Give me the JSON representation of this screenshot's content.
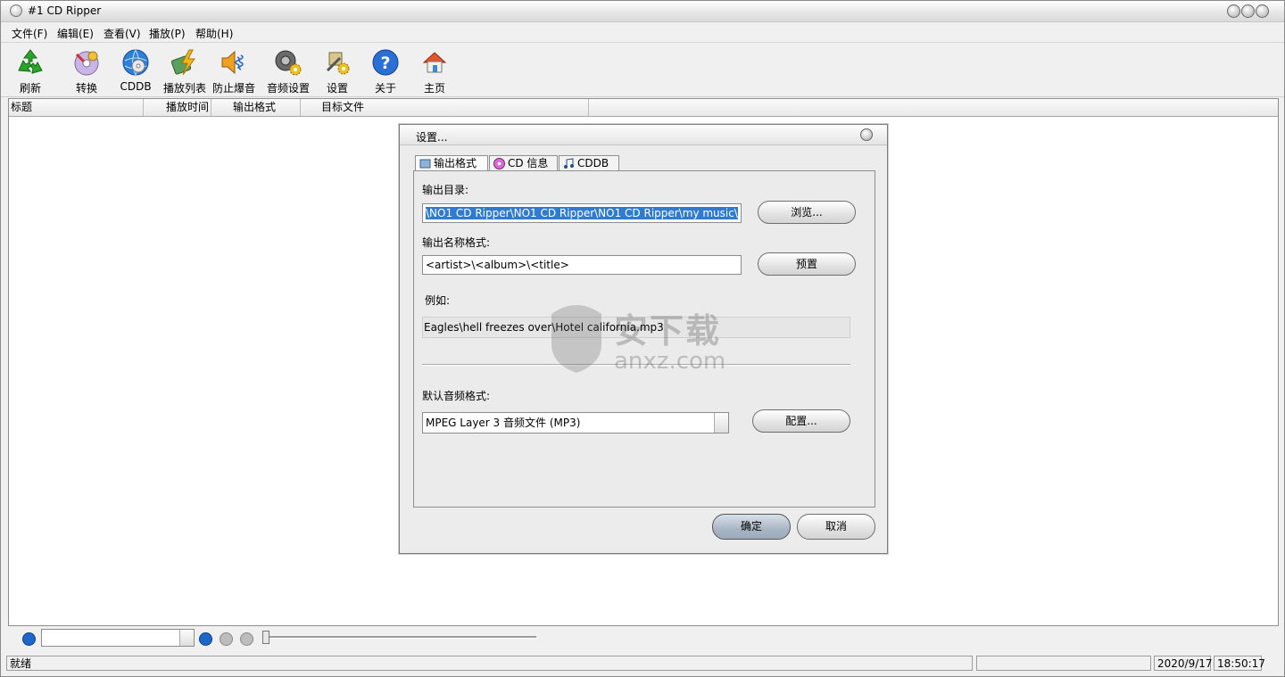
{
  "window": {
    "title": "#1 CD Ripper"
  },
  "menu": [
    {
      "label": "文件(F)"
    },
    {
      "label": "编辑(E)"
    },
    {
      "label": "查看(V)"
    },
    {
      "label": "播放(P)"
    },
    {
      "label": "帮助(H)"
    }
  ],
  "toolbar": [
    {
      "label": "刷新",
      "icon": "recycle-icon"
    },
    {
      "label": "转换",
      "icon": "disc-convert-icon"
    },
    {
      "label": "CDDB",
      "icon": "globe-disc-icon"
    },
    {
      "label": "播放列表",
      "icon": "playlist-lightning-icon"
    },
    {
      "label": "防止爆音",
      "icon": "speaker-wave-icon"
    },
    {
      "label": "音频设置",
      "icon": "speaker-gear-icon"
    },
    {
      "label": "设置",
      "icon": "settings-tools-icon"
    },
    {
      "label": "关于",
      "icon": "help-icon"
    },
    {
      "label": "主页",
      "icon": "home-icon"
    }
  ],
  "columns": [
    "标题",
    "播放时间",
    "输出格式",
    "目标文件"
  ],
  "dialog": {
    "title": "设置...",
    "tabs": [
      {
        "label": "输出格式"
      },
      {
        "label": "CD 信息"
      },
      {
        "label": "CDDB"
      }
    ],
    "output_dir_label": "输出目录:",
    "output_dir_value": "\\NO1 CD Ripper\\NO1 CD Ripper\\NO1 CD Ripper\\my music\\",
    "browse_label": "浏览...",
    "name_format_label": "输出名称格式:",
    "name_format_value": "<artist>\\<album>\\<title>",
    "preset_label": "预置",
    "example_label": "例如:",
    "example_value": "Eagles\\hell freezes over\\Hotel california.mp3",
    "default_format_label": "默认音频格式:",
    "default_format_value": "MPEG Layer 3 音频文件 (MP3)",
    "config_label": "配置...",
    "ok_label": "确定",
    "cancel_label": "取消"
  },
  "watermark": {
    "text": "安下载",
    "sub": "anxz.com"
  },
  "status": {
    "text": "就绪",
    "date": "2020/9/17",
    "time": "18:50:17"
  },
  "colors": {
    "selection": "#2e7bd1",
    "accent_blue": "#1f66c9"
  }
}
